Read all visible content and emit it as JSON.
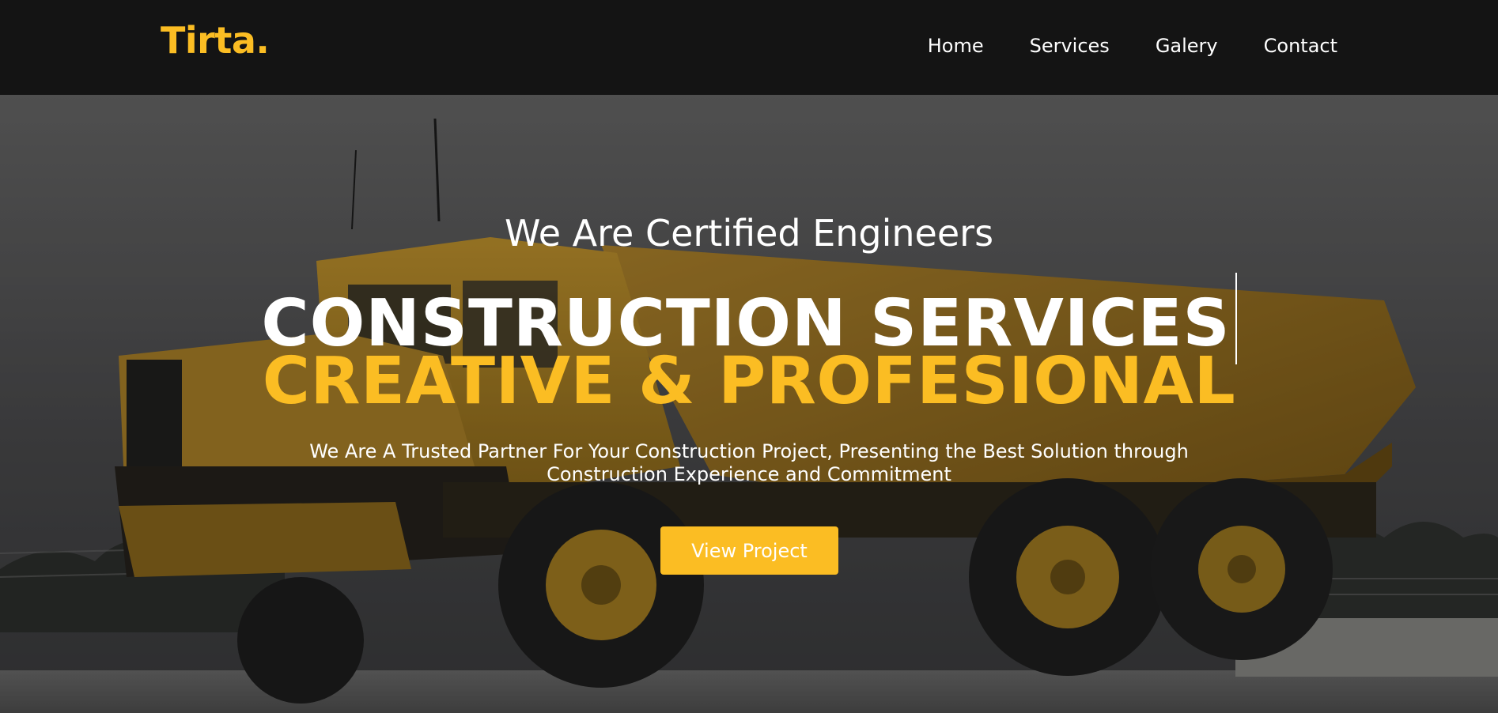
{
  "header": {
    "logo": "Tirta.",
    "nav": [
      {
        "label": "Home"
      },
      {
        "label": "Services"
      },
      {
        "label": "Galery"
      },
      {
        "label": "Contact"
      }
    ]
  },
  "hero": {
    "eyebrow": "We Are Certified Engineers",
    "title_line_1": "CONSTRUCTION SERVICES",
    "title_line_2": "CREATIVE & PROFESIONAL",
    "subtitle": "We Are A Trusted Partner For Your Construction Project, Presenting the Best Solution through Construction Experience and Commitment",
    "cta_label": "View Project",
    "background_image": "yellow articulated dump truck parked on gravel under a grey cloudy sky"
  },
  "colors": {
    "accent": "#fbbd23",
    "header_bg": "#141414",
    "text": "#ffffff"
  }
}
